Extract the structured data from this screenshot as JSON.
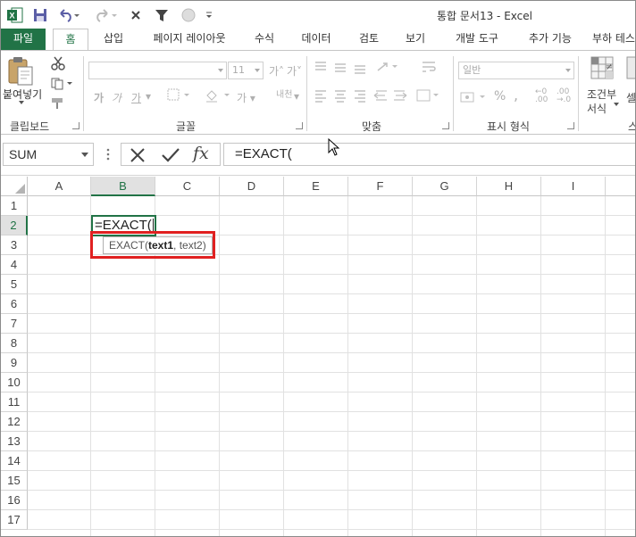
{
  "window": {
    "title": "통합 문서13 - Excel",
    "app_icon": "excel-icon",
    "quick_access": [
      "save-icon",
      "undo-icon",
      "redo-icon",
      "close-x-icon",
      "filter-icon",
      "circle-icon",
      "customize-icon"
    ]
  },
  "ribbon_tabs": [
    "파일",
    "홈",
    "삽입",
    "페이지 레이아웃",
    "수식",
    "데이터",
    "검토",
    "보기",
    "개발 도구",
    "추가 기능",
    "부하 테스"
  ],
  "ribbon": {
    "clipboard": {
      "paste_label": "붙여넣기",
      "group_label": "클립보드"
    },
    "font": {
      "size_value": "11",
      "bold": "가",
      "italic": "가",
      "underline": "가",
      "group_label": "글꼴",
      "phonetic": "내천"
    },
    "alignment": {
      "group_label": "맞춤"
    },
    "number": {
      "format_value": "일반",
      "percent": "%",
      "comma": ",",
      "group_label": "표시 형식"
    },
    "styles": {
      "conditional_label_1": "조건부",
      "conditional_label_2": "서식",
      "cell_style_label": "셀",
      "group_label": "스"
    }
  },
  "formula_bar": {
    "name_box": "SUM",
    "formula": "=EXACT("
  },
  "grid": {
    "columns": [
      "A",
      "B",
      "C",
      "D",
      "E",
      "F",
      "G",
      "H",
      "I"
    ],
    "rows": [
      "1",
      "2",
      "3",
      "4",
      "5",
      "6",
      "7",
      "8",
      "9",
      "10",
      "11",
      "12",
      "13",
      "14",
      "15",
      "16",
      "17"
    ],
    "selected_column": "B",
    "selected_row": "2",
    "active_cell_value": "=EXACT(",
    "tooltip": {
      "fn": "EXACT(",
      "arg1": "text1",
      "rest": ", text2)"
    }
  },
  "colors": {
    "excel_green": "#217346",
    "highlight_red": "#e02020"
  }
}
